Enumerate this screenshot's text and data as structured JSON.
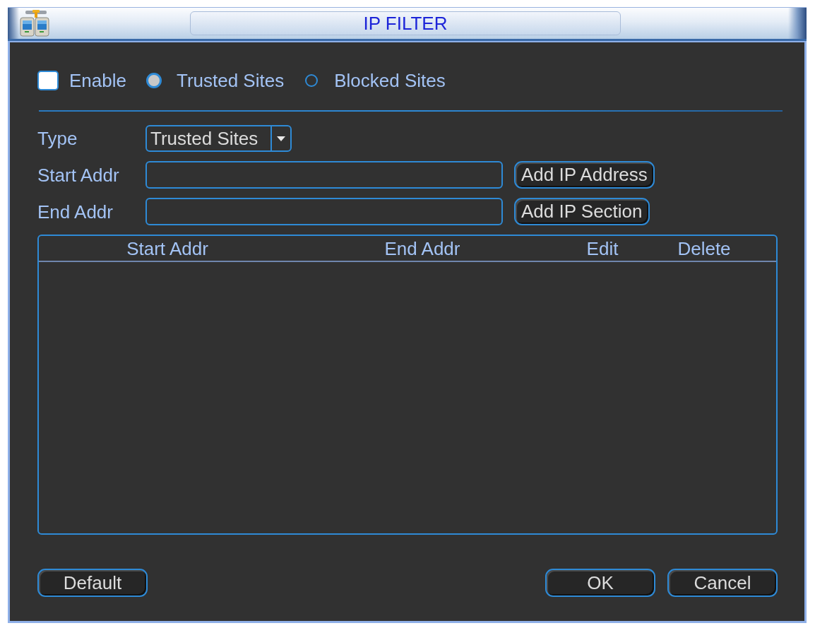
{
  "window": {
    "title": "IP FILTER"
  },
  "mode": {
    "enable": {
      "label": "Enable",
      "checked": false
    },
    "options": [
      {
        "label": "Trusted Sites",
        "selected": true
      },
      {
        "label": "Blocked Sites",
        "selected": false
      }
    ]
  },
  "form": {
    "rows": [
      {
        "kind": "select",
        "label": "Type",
        "value": "Trusted Sites"
      },
      {
        "kind": "input",
        "label": "Start Addr",
        "button": "Add IP Address"
      },
      {
        "kind": "input",
        "label": "End Addr",
        "button": "Add IP Section"
      }
    ]
  },
  "table": {
    "columns": [
      "Start Addr",
      "End Addr",
      "Edit",
      "Delete"
    ]
  },
  "footer": {
    "left_buttons": [
      "Default"
    ],
    "right_buttons": [
      "OK",
      "Cancel"
    ]
  }
}
